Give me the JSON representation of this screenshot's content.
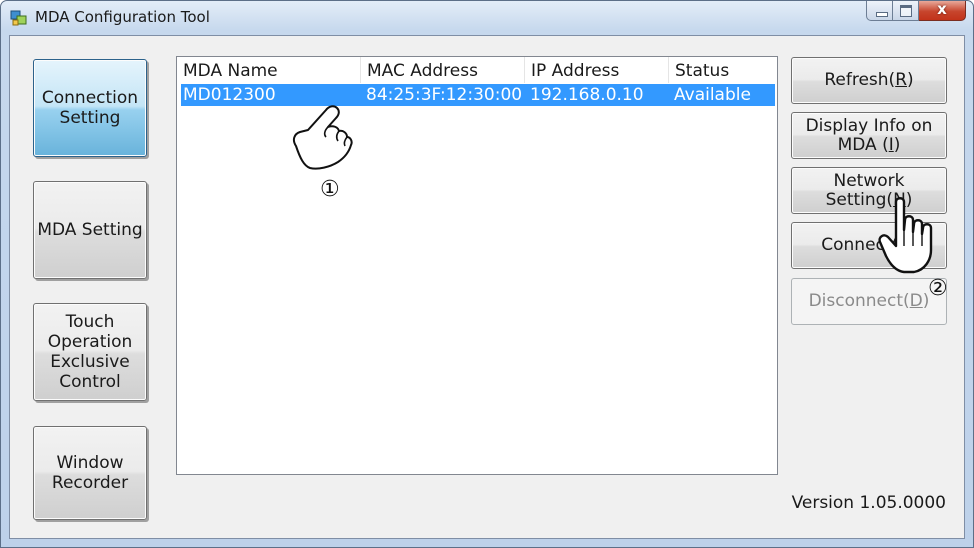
{
  "window": {
    "title": "MDA Configuration Tool",
    "minimize_icon": "minimize-icon",
    "maximize_icon": "maximize-icon",
    "close_glyph": "x"
  },
  "nav": {
    "connection_setting": "Connection\nSetting",
    "mda_setting": "MDA Setting",
    "touch_operation": "Touch\nOperation\nExclusive\nControl",
    "window_recorder": "Window\nRecorder"
  },
  "list": {
    "headers": [
      "MDA Name",
      "MAC Address",
      "IP Address",
      "Status"
    ],
    "rows": [
      [
        "MD012300",
        "84:25:3F:12:30:00",
        "192.168.0.10",
        "Available"
      ]
    ]
  },
  "actions": {
    "refresh": "Refresh(",
    "refresh_key": "R",
    "close_paren": ")",
    "display_info": "Display Info on\nMDA (",
    "display_info_key": "I",
    "network_setting": "Network\nSetting(",
    "network_setting_key": "N",
    "connect": "Connect(",
    "connect_key": "C",
    "disconnect": "Disconnect(",
    "disconnect_key": "D"
  },
  "version": "Version 1.05.0000",
  "callouts": {
    "one": "①",
    "two": "②"
  },
  "colors": {
    "selection": "#3399ff",
    "active_nav": "#98d1ef"
  }
}
